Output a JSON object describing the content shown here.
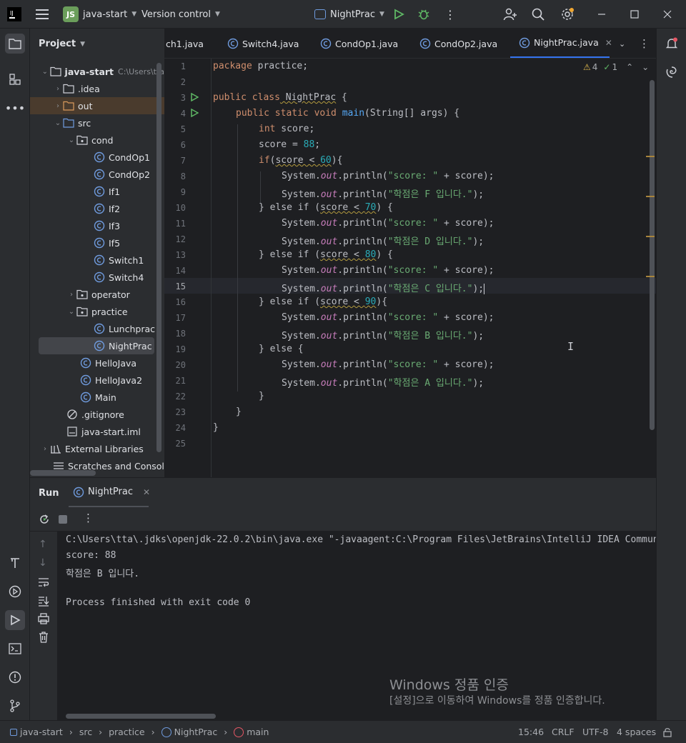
{
  "titlebar": {
    "project_badge": "JS",
    "project_name": "java-start",
    "vcs_label": "Version control",
    "run_config": "NightPrac"
  },
  "project_panel": {
    "title": "Project",
    "root_name": "java-start",
    "root_path": "C:\\Users\\tta",
    "items": [
      {
        "label": ".idea"
      },
      {
        "label": "out"
      },
      {
        "label": "src"
      },
      {
        "label": "cond"
      },
      {
        "label": "CondOp1"
      },
      {
        "label": "CondOp2"
      },
      {
        "label": "If1"
      },
      {
        "label": "If2"
      },
      {
        "label": "If3"
      },
      {
        "label": "If5"
      },
      {
        "label": "Switch1"
      },
      {
        "label": "Switch4"
      },
      {
        "label": "operator"
      },
      {
        "label": "practice"
      },
      {
        "label": "Lunchprac"
      },
      {
        "label": "NightPrac"
      },
      {
        "label": "HelloJava"
      },
      {
        "label": "HelloJava2"
      },
      {
        "label": "Main"
      },
      {
        "label": ".gitignore"
      },
      {
        "label": "java-start.iml"
      },
      {
        "label": "External Libraries"
      },
      {
        "label": "Scratches and Consoles"
      }
    ]
  },
  "tabs": [
    {
      "label": "ch1.java"
    },
    {
      "label": "Switch4.java"
    },
    {
      "label": "CondOp1.java"
    },
    {
      "label": "CondOp2.java"
    },
    {
      "label": "NightPrac.java"
    }
  ],
  "editor": {
    "warnings": "4",
    "weak_warnings": "1",
    "line_numbers": [
      "1",
      "2",
      "3",
      "4",
      "5",
      "6",
      "7",
      "8",
      "9",
      "10",
      "11",
      "12",
      "13",
      "14",
      "15",
      "16",
      "17",
      "18",
      "19",
      "20",
      "21",
      "22",
      "23",
      "24",
      "25"
    ],
    "code": {
      "l1": [
        "package",
        " practice;"
      ],
      "l3": [
        "public class",
        " NightPrac",
        " {"
      ],
      "l4": [
        "public static void",
        " main",
        "(String[] args) {"
      ],
      "l5": [
        "int",
        " score;"
      ],
      "l6": [
        "score = ",
        "88",
        ";"
      ],
      "l7": [
        "if",
        "(",
        "score < ",
        "60",
        "){"
      ],
      "print_prefix": "System.",
      "print_field": "out",
      "print_method": ".println(",
      "print_end": ");",
      "score_str": "\"score: \"",
      "score_concat": " + score",
      "l9_str": "\"학점은 F 입니다.\"",
      "l12_str": "\"학점은 D 입니다.\"",
      "l15_str": "\"학점은 C 입니다.\"",
      "l18_str": "\"학점은 B 입니다.\"",
      "l21_str": "\"학점은 A 입니다.\"",
      "else_if": "} else if (",
      "cond_score": "score < ",
      "n70": "70",
      "n80": "80",
      "n90": "90",
      "close_paren_brace": ") {",
      "close_paren_brace2": "){",
      "l19": "} else {",
      "close_brace": "}"
    }
  },
  "run": {
    "tab_title": "Run",
    "config_tab": "NightPrac",
    "console_lines": [
      "C:\\Users\\tta\\.jdks\\openjdk-22.0.2\\bin\\java.exe \"-javaagent:C:\\Program Files\\JetBrains\\IntelliJ IDEA Community",
      "score: 88",
      "학점은 B 입니다.",
      "",
      "Process finished with exit code 0"
    ]
  },
  "watermark": {
    "title": "Windows 정품 인증",
    "subtitle": "[설정]으로 이동하여 Windows를 정품 인증합니다."
  },
  "statusbar": {
    "breadcrumb": [
      "java-start",
      "src",
      "practice",
      "NightPrac",
      "main"
    ],
    "position": "15:46",
    "line_sep": "CRLF",
    "encoding": "UTF-8",
    "indent": "4 spaces"
  },
  "colors": {
    "accent": "#3574f0",
    "keyword": "#cf8e6d",
    "string": "#6aab73",
    "number": "#2aacb8",
    "field": "#c77dbb",
    "run_green": "#5fb865"
  },
  "icons": [
    "app-logo-icon",
    "hamburger-menu-icon",
    "run-icon",
    "debug-icon",
    "more-vertical-icon",
    "add-user-icon",
    "search-icon",
    "settings-icon",
    "minimize-icon",
    "maximize-icon",
    "close-icon",
    "folder-icon",
    "structure-icon",
    "more-horizontal-icon",
    "build-icon",
    "services-icon",
    "run-tool-icon",
    "terminal-icon",
    "problems-icon",
    "git-icon",
    "notifications-icon",
    "ai-icon",
    "class-icon",
    "rerun-icon",
    "stop-icon",
    "arrow-up-icon",
    "arrow-down-icon",
    "soft-wrap-icon",
    "scroll-end-icon",
    "print-icon",
    "trash-icon",
    "lock-icon"
  ]
}
